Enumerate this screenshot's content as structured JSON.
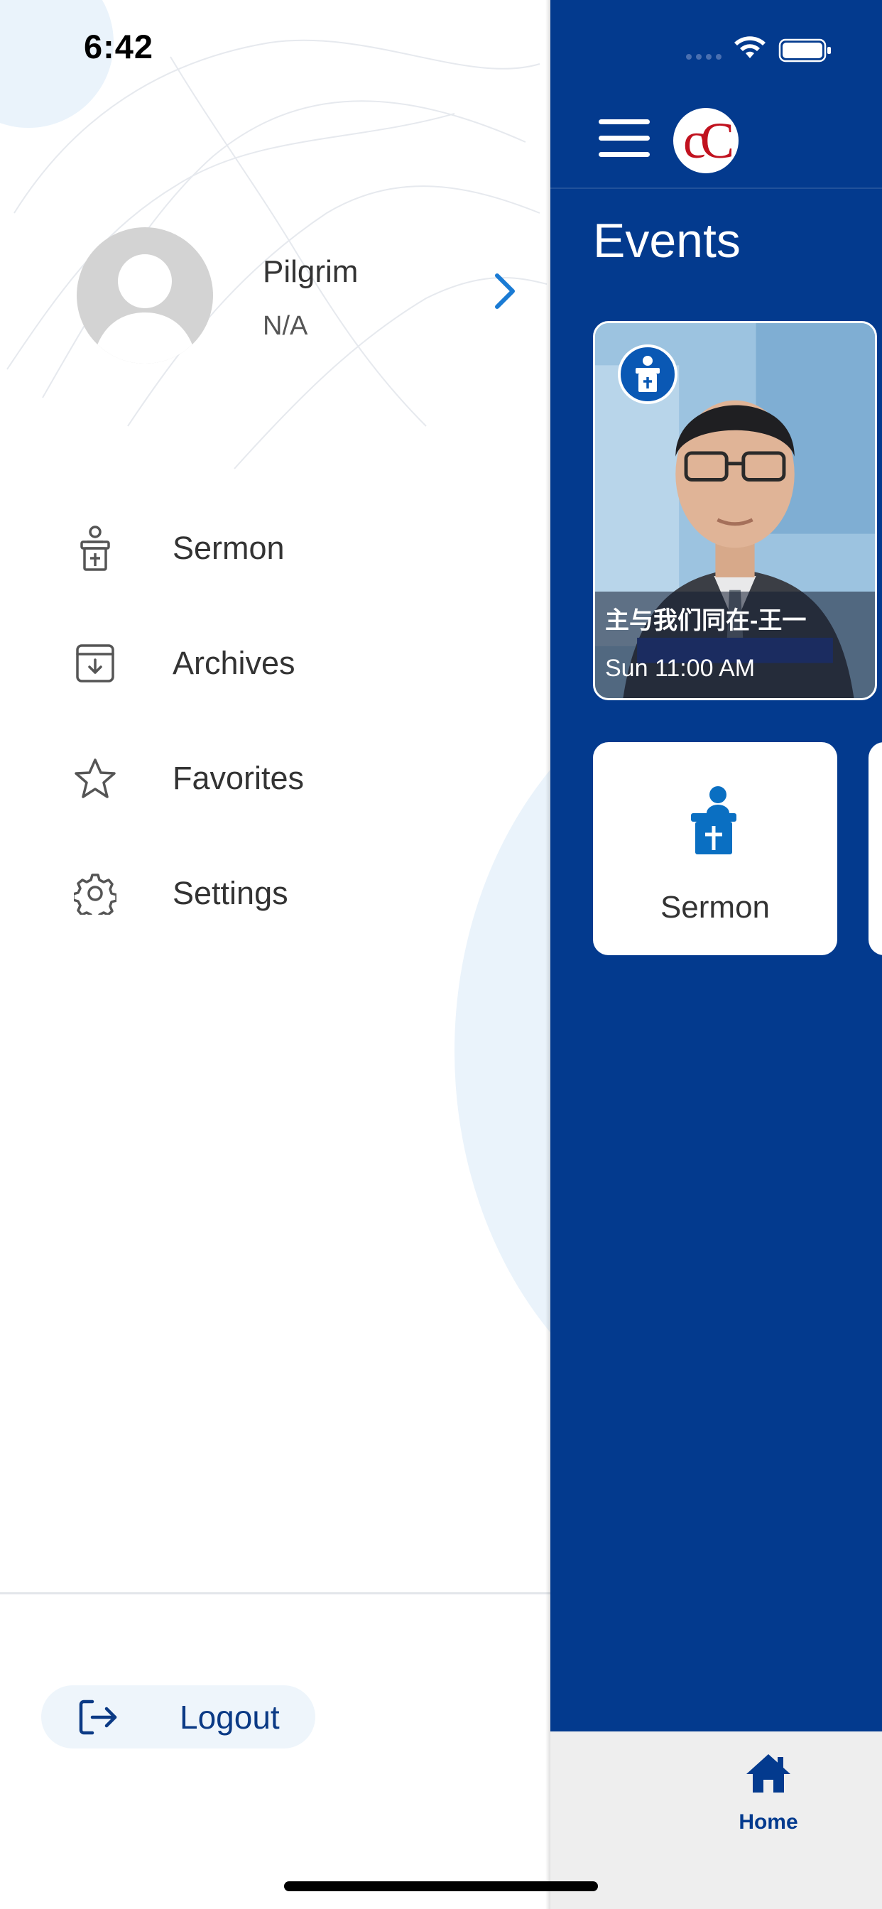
{
  "status_bar": {
    "time": "6:42"
  },
  "profile": {
    "name": "Pilgrim",
    "subtitle": "N/A"
  },
  "menu": {
    "items": [
      {
        "label": "Sermon",
        "icon": "pulpit-icon"
      },
      {
        "label": "Archives",
        "icon": "archive-icon"
      },
      {
        "label": "Favorites",
        "icon": "star-icon"
      },
      {
        "label": "Settings",
        "icon": "gear-icon"
      }
    ]
  },
  "logout": {
    "label": "Logout",
    "icon": "logout-icon"
  },
  "main": {
    "events_title": "Events",
    "logo_text": "cC",
    "event": {
      "title": "主与我们同在-王一",
      "time": "Sun 11:00 AM"
    },
    "tiles": [
      {
        "label": "Sermon",
        "icon": "pulpit-icon"
      }
    ]
  },
  "tabbar": {
    "home_label": "Home",
    "icon": "home-icon"
  },
  "colors": {
    "brand_blue": "#033a8e",
    "accent_blue": "#0a58b4",
    "logo_red": "#c1121f",
    "logout_text": "#0b3a85"
  }
}
